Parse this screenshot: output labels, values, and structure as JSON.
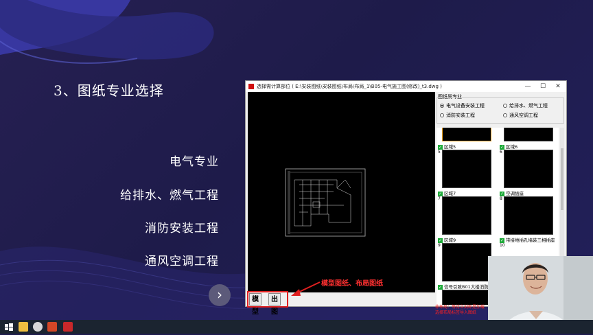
{
  "slide": {
    "title": "3、图纸专业选择",
    "options": [
      "电气专业",
      "给排水、燃气工程",
      "消防安装工程",
      "通风空调工程"
    ],
    "next_icon": "chevron-right-icon"
  },
  "window": {
    "title": "选择需计算部位 ( E:\\安装图纸\\安装图纸\\布局\\布局_1\\B05-电气施工图(修改)_t3.dwg )",
    "controls": {
      "minimize": "—",
      "maximize": "☐",
      "close": "✕"
    },
    "tabs": {
      "model": "模型",
      "layout": "出图"
    },
    "annotation": "模型图纸、布局图纸",
    "panel": {
      "group_label": "图纸属专业",
      "radios": [
        {
          "label": "电气设备安装工程",
          "checked": true
        },
        {
          "label": "给排水、燃气工程",
          "checked": false
        },
        {
          "label": "消防安装工程",
          "checked": false
        },
        {
          "label": "通风空调工程",
          "checked": false
        }
      ],
      "thumbnails": [
        {
          "label": "区域5",
          "num": "5"
        },
        {
          "label": "区域6",
          "num": "6"
        },
        {
          "label": "区域7",
          "num": "7"
        },
        {
          "label": "空调插座",
          "num": "8"
        },
        {
          "label": "区域9",
          "num": "9"
        },
        {
          "label": "带接地插孔墙装三相插座",
          "num": "10"
        },
        {
          "label": "信号引致B01大楼消防控",
          "num": ""
        }
      ],
      "warning": "非布局：等待立刻即是加载 选择布局标签导入图纸"
    }
  },
  "taskbar": {
    "icons": [
      "windows-start-icon",
      "file-explorer-icon",
      "browser-icon",
      "powerpoint-icon",
      "cad-app-icon"
    ]
  },
  "colors": {
    "background": "#1f1c4d",
    "accent_red": "#e02020",
    "check_green": "#1faa3a"
  }
}
